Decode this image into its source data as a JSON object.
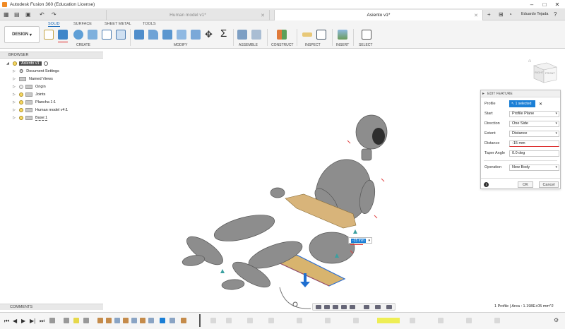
{
  "app": {
    "window_title": "Autodesk Fusion 360 (Education License)",
    "user_name": "Eduardo Tejada"
  },
  "tabs": [
    {
      "label": "Human model v1*",
      "active": false
    },
    {
      "label": "Asiento v1*",
      "active": true
    }
  ],
  "ribbon": {
    "workspace": "DESIGN",
    "tabs": [
      "SOLID",
      "SURFACE",
      "SHEET METAL",
      "TOOLS"
    ],
    "active_tab": "SOLID",
    "groups": [
      "CREATE",
      "MODIFY",
      "ASSEMBLE",
      "CONSTRUCT",
      "INSPECT",
      "INSERT",
      "SELECT"
    ]
  },
  "browser": {
    "title": "BROWSER",
    "items": [
      {
        "label": "Asiento v1",
        "root": true
      },
      {
        "label": "Document Settings"
      },
      {
        "label": "Named Views"
      },
      {
        "label": "Origin"
      },
      {
        "label": "Joints"
      },
      {
        "label": "Plancha 1:1"
      },
      {
        "label": "Human model v4:1"
      },
      {
        "label": "Base:1"
      }
    ]
  },
  "viewcube": {
    "top_label": "TOP",
    "front_label": "FRONT",
    "side_label": "RIGHT"
  },
  "edit_feature": {
    "title": "EDIT FEATURE",
    "rows": [
      {
        "label": "Profile",
        "value": "1 selected"
      },
      {
        "label": "Start",
        "value": "Profile Plane"
      },
      {
        "label": "Direction",
        "value": "One Side"
      },
      {
        "label": "Extent",
        "value": "Distance"
      },
      {
        "label": "Distance",
        "value": "-15 mm"
      },
      {
        "label": "Taper Angle",
        "value": "0.0 deg"
      },
      {
        "label": "Operation",
        "value": "New Body"
      }
    ],
    "ok_label": "OK",
    "cancel_label": "Cancel",
    "info_icon": "info-icon"
  },
  "inline_distance": "-15 mm",
  "comments_label": "COMMENTS",
  "status_text": "1 Profile | Area : 1.198E+05 mm^2",
  "colors": {
    "accent": "#1a6ab8",
    "selection": "#2f8fe0",
    "model": "#8a8a8a",
    "extrude": "#d1b078"
  }
}
